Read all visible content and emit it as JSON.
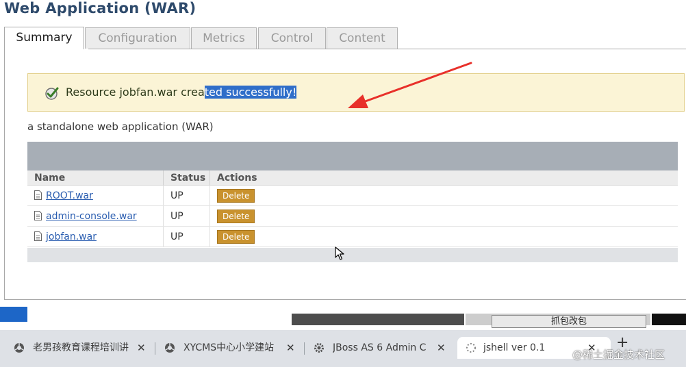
{
  "page_title": "Web Application (WAR)",
  "tabs": [
    {
      "label": "Summary",
      "active": true
    },
    {
      "label": "Configuration",
      "active": false
    },
    {
      "label": "Metrics",
      "active": false
    },
    {
      "label": "Control",
      "active": false
    },
    {
      "label": "Content",
      "active": false
    }
  ],
  "message": {
    "icon": "check-circle-icon",
    "text_before": "Resource jobfan.war crea",
    "text_selected": "ted successfully!"
  },
  "description": "a standalone web application (WAR)",
  "grid": {
    "columns": [
      "Name",
      "Status",
      "Actions"
    ],
    "rows": [
      {
        "name": "ROOT.war",
        "status": "UP",
        "action": "Delete"
      },
      {
        "name": "admin-console.war",
        "status": "UP",
        "action": "Delete"
      },
      {
        "name": "jobfan.war",
        "status": "UP",
        "action": "Delete"
      }
    ]
  },
  "background_app": {
    "button_label": "抓包改包"
  },
  "browser_tabs": [
    {
      "title": "老男孩教育课程培训讲",
      "icon": "globe-icon"
    },
    {
      "title": "XYCMS中心小学建站",
      "icon": "globe-icon"
    },
    {
      "title": "JBoss AS 6 Admin C",
      "icon": "gear-icon"
    },
    {
      "title": "jshell ver 0.1",
      "icon": "loading-icon",
      "active": true
    }
  ],
  "watermark": "@稀土掘金技术社区",
  "colors": {
    "title": "#2e4a6b",
    "success_bg": "#fbf4d6",
    "selection": "#2f6ec9",
    "delete_button": "#c9922e",
    "arrow": "#e8302a",
    "grid_header": "#a7aeb6"
  }
}
